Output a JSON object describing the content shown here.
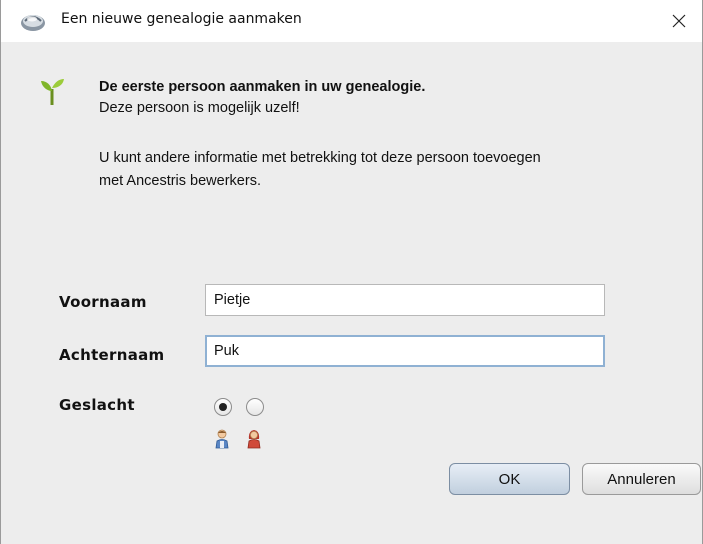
{
  "window": {
    "title": "Een nieuwe genealogie aanmaken",
    "app_icon": "ancestris-app-icon",
    "close_icon": "close-icon"
  },
  "intro": {
    "icon": "sprout-icon",
    "heading": "De eerste persoon aanmaken in uw genealogie.",
    "line1": "Deze persoon is mogelijk uzelf!",
    "line2": "U kunt andere informatie met betrekking tot deze persoon toevoegen",
    "line3": "met Ancestris bewerkers."
  },
  "form": {
    "firstname": {
      "label": "Voornaam",
      "value": "Pietje"
    },
    "lastname": {
      "label": "Achternaam",
      "value": "Puk"
    },
    "gender": {
      "label": "Geslacht",
      "options": [
        {
          "icon": "male-person-icon",
          "selected": true
        },
        {
          "icon": "female-person-icon",
          "selected": false
        }
      ]
    }
  },
  "buttons": {
    "ok": "OK",
    "cancel": "Annuleren"
  }
}
